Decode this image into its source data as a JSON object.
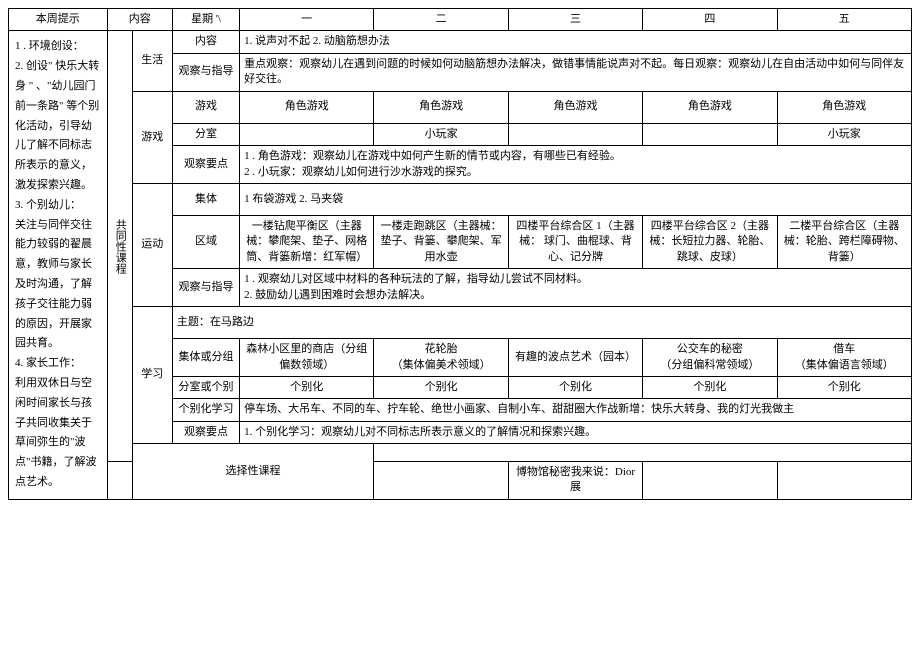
{
  "header": {
    "tips_title": "本周提示",
    "content_title": "内容",
    "weekday_title": "星期 '\\",
    "day1": "一",
    "day2": "二",
    "day3": "三",
    "day4": "四",
    "day5": "五"
  },
  "tips": "1       . 环境创设：\n2. 创设\" 快乐大转身 \" 、\"幼儿园门前一条路\" 等个别化活动，引导幼儿了解不同标志所表示的意义，激发探索兴趣。\n3. 个别幼儿：\n关注与同伴交往能力较弱的翟晨意，教师与家长及时沟通，了解孩子交往能力弱的原因，开展家园共育。\n4. 家长工作：\n利用双休日与空闲时间家长与孩子共同收集关于草间弥生的\"波点\"书籍，了解波点艺术。",
  "common_course": "共同性课程",
  "life": {
    "title": "生活",
    "content_label": "内容",
    "content_value": "1. 说声对不起           2. 动脑筋想办法",
    "guide_label": "观察与指导",
    "guide_value": "重点观察：观察幼儿在遇到问题的时候如何动脑筋想办法解决，做错事情能说声对不起。每日观察：观察幼儿在自由活动中如何与同伴友好交往。"
  },
  "game": {
    "title": "游戏",
    "game_label": "游戏",
    "g1": "角色游戏",
    "g2": "角色游戏",
    "g3": "角色游戏",
    "g4": "角色游戏",
    "g5": "角色游戏",
    "room_label": "分室",
    "r1": "",
    "r2": "小玩家",
    "r3": "",
    "r4": "",
    "r5": "小玩家",
    "obs_label": "观察要点",
    "obs_value": "1           . 角色游戏：观察幼儿在游戏中如何产生新的情节或内容，有哪些已有经验。\n2           . 小玩家：观察幼儿如何进行沙水游戏的探究。"
  },
  "sport": {
    "title": "运动",
    "group_label": "集体",
    "group_value": "1 布袋游戏             2. 马夹袋",
    "area_label": "区域",
    "a1": "一楼钻爬平衡区（主器械：攀爬架、垫子、网格筒、背篓新增：红军帽）",
    "a2": "一楼走跑跳区（主器械：垫子、背篓、攀爬架、军用水壶",
    "a3": "四楼平台综合区 1（主器械：  球门、曲棍球、背心、记分牌",
    "a4": "四楼平台综合区 2（主器械：长短拉力器、轮胎、跳球、皮球）",
    "a5": "二楼平台综合区（主器械：轮胎、跨栏障碍物、背篓）",
    "guide_label": "观察与指导",
    "guide_value": "1         . 观察幼儿对区域中材料的各种玩法的了解，指导幼儿尝试不同材料。\n2. 鼓励幼儿遇到困难时会想办法解决。"
  },
  "learn": {
    "title": "学习",
    "topic": "主题：在马路边",
    "group_label": "集体或分组",
    "g1": "森林小区里的商店（分组偏数领域）",
    "g2": "花轮胎\n（集体偏美术领域）",
    "g3": "有趣的波点艺术（园本）",
    "g4": "公交车的秘密\n（分组偏科常领域）",
    "g5": "借车\n（集体偏语言领域）",
    "room_label": "分室或个别",
    "r1": "个别化",
    "r2": "个别化",
    "r3": "个别化",
    "r4": "个别化",
    "r5": "个别化",
    "indiv_label": "个别化学习",
    "indiv_value": "停车场、大吊车、不同的车、拧车轮、绝世小画家、自制小车、甜甜圈大作战新增：快乐大转身、我的灯光我做主",
    "obs_label": "观察要点",
    "obs_value": "1. 个别化学习：观察幼儿对不同标志所表示意义的了解情况和探索兴趣。"
  },
  "elective": {
    "title": "选择性课程",
    "e1": "",
    "e2": "",
    "e3": "博物馆秘密我来说：Dior 展",
    "e4": "",
    "e5": ""
  }
}
